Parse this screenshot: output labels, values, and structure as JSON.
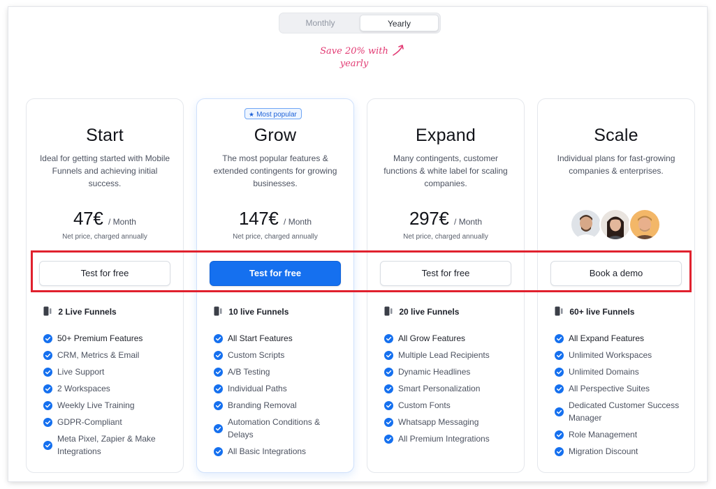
{
  "billing_toggle": {
    "monthly": "Monthly",
    "yearly": "Yearly",
    "selected": "Yearly"
  },
  "save_note": "Save 20% with yearly",
  "popular_badge": "Most popular",
  "colors": {
    "primary": "#1570ef",
    "check": "#1570ef",
    "annotation": "#e0212e",
    "note": "#e23a73"
  },
  "plans": [
    {
      "name": "Start",
      "description": "Ideal for getting started with Mobile Funnels and achieving initial success.",
      "price": "47€",
      "period": "/ Month",
      "price_note": "Net price, charged annually",
      "cta": "Test for free",
      "funnels": "2 Live Funnels",
      "features": [
        "50+ Premium Features",
        "CRM, Metrics & Email",
        "Live Support",
        "2 Workspaces",
        "Weekly Live Training",
        "GDPR-Compliant",
        "Meta Pixel, Zapier & Make Integrations"
      ]
    },
    {
      "name": "Grow",
      "description": "The most popular features & extended contingents for growing businesses.",
      "price": "147€",
      "period": "/ Month",
      "price_note": "Net price, charged annually",
      "cta": "Test for free",
      "funnels": "10 live Funnels",
      "features": [
        "All Start Features",
        "Custom Scripts",
        "A/B Testing",
        "Individual Paths",
        "Branding Removal",
        "Automation Conditions & Delays",
        "All Basic Integrations"
      ]
    },
    {
      "name": "Expand",
      "description": "Many contingents, customer functions & white label for scaling companies.",
      "price": "297€",
      "period": "/ Month",
      "price_note": "Net price, charged annually",
      "cta": "Test for free",
      "funnels": "20 live Funnels",
      "features": [
        "All Grow Features",
        "Multiple Lead Recipients",
        "Dynamic Headlines",
        "Smart Personalization",
        "Custom Fonts",
        "Whatsapp Messaging",
        "All Premium Integrations"
      ]
    },
    {
      "name": "Scale",
      "description": "Individual plans for fast-growing companies & enterprises.",
      "cta": "Book a demo",
      "funnels": "60+ live Funnels",
      "features": [
        "All Expand Features",
        "Unlimited Workspaces",
        "Unlimited Domains",
        "All Perspective Suites",
        "Dedicated Customer Success Manager",
        "Role Management",
        "Migration Discount"
      ]
    }
  ]
}
